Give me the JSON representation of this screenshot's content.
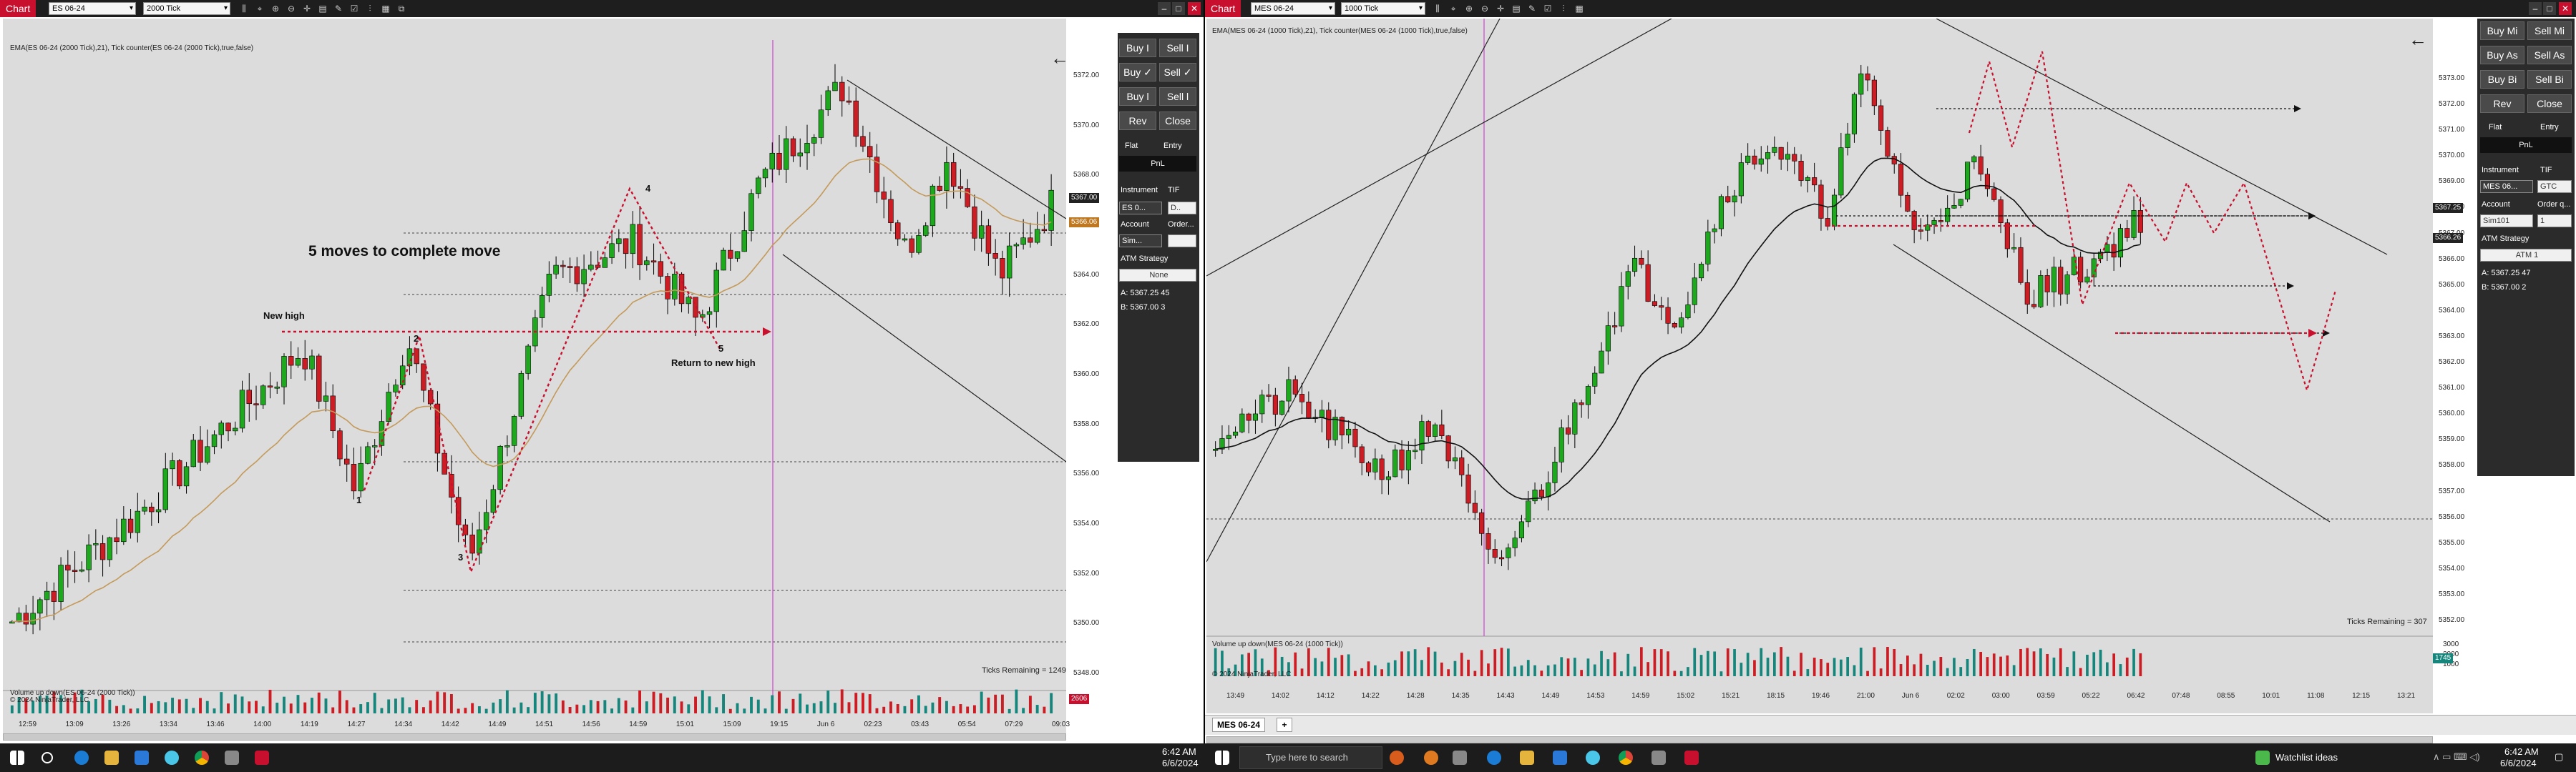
{
  "colors": {
    "up": "#1ea81e",
    "down": "#cc1d24",
    "accent": "#c8102e",
    "volume_badge": "#16867c",
    "price_badge": "#c07820",
    "ema": "#c49a5b"
  },
  "left": {
    "tab": "Chart",
    "instrument": "ES 06-24",
    "interval": "2000 Tick",
    "indicator_label": "EMA(ES 06-24 (2000 Tick),21), Tick counter(ES 06-24 (2000 Tick),true,false)",
    "annotations": {
      "title": "5 moves to complete move",
      "new_high": "New high",
      "return": "Return to new high",
      "n1": "1",
      "n2": "2",
      "n3": "3",
      "n4": "4",
      "n5": "5"
    },
    "ticks_remaining": "Ticks Remaining = 1249",
    "volume_label": "Volume up down(ES 06-24 (2000 Tick))",
    "copyright": "© 2024 NinjaTrader, LLC",
    "price_axis": [
      "5372.00",
      "5370.00",
      "5368.00",
      "5366.00",
      "5364.00",
      "5362.00",
      "5360.00",
      "5358.00",
      "5356.00",
      "5354.00",
      "5352.00",
      "5350.00",
      "5348.00"
    ],
    "price_badge_dark": "5367.00",
    "price_badge_gold": "5366.06",
    "volume_badge": "2606",
    "time_axis": [
      "12:59",
      "13:09",
      "13:26",
      "13:34",
      "13:46",
      "14:00",
      "14:19",
      "14:27",
      "14:34",
      "14:42",
      "14:49",
      "14:51",
      "14:56",
      "14:59",
      "15:01",
      "15:09",
      "19:15",
      "Jun 6",
      "02:23",
      "03:43",
      "05:54",
      "07:29",
      "09:03"
    ],
    "panel": {
      "buy1": "Buy I",
      "sell1": "Sell I",
      "buy2": "Buy ✓",
      "sell2": "Sell ✓",
      "buy3": "Buy l",
      "sell3": "Sell l",
      "rev": "Rev",
      "close": "Close",
      "flat": "Flat",
      "entry": "Entry",
      "pnl": "PnL",
      "instrument": "Instrument",
      "tif": "TIF",
      "instr_val": "ES 0...",
      "tif_val": "D..",
      "account": "Account",
      "order": "Order...",
      "account_val": "Sim...",
      "atm": "ATM Strategy",
      "atm_val": "None",
      "ask": "A:  5367.25   45",
      "bid": "B:  5367.00   3"
    }
  },
  "right": {
    "tab": "Chart",
    "instrument": "MES 06-24",
    "interval": "1000 Tick",
    "indicator_label": "EMA(MES 06-24 (1000 Tick),21), Tick counter(MES 06-24 (1000 Tick),true,false)",
    "ticks_remaining": "Ticks Remaining = 307",
    "volume_label": "Volume up down(MES 06-24 (1000 Tick))",
    "copyright": "© 2024 NinjaTrader, LLC",
    "tab_label": "MES 06-24",
    "price_axis": [
      "5373.00",
      "5372.00",
      "5371.00",
      "5370.00",
      "5369.00",
      "5368.00",
      "5367.00",
      "5366.00",
      "5365.00",
      "5364.00",
      "5363.00",
      "5362.00",
      "5361.00",
      "5360.00",
      "5359.00",
      "5358.00",
      "5357.00",
      "5356.00",
      "5355.00",
      "5354.00",
      "5353.00",
      "5352.00"
    ],
    "price_badge_a": "5367.25",
    "price_badge_b": "5366.26",
    "vol_axis": [
      "3000",
      "2000",
      "1000"
    ],
    "volume_badge": "1745",
    "time_axis": [
      "13:49",
      "14:02",
      "14:12",
      "14:22",
      "14:28",
      "14:35",
      "14:43",
      "14:49",
      "14:53",
      "14:59",
      "15:02",
      "15:21",
      "18:15",
      "19:46",
      "21:00",
      "Jun 6",
      "02:02",
      "03:00",
      "03:59",
      "05:22",
      "06:42",
      "07:48",
      "08:55",
      "10:01",
      "11:08",
      "12:15",
      "13:21"
    ],
    "panel": {
      "buy1": "Buy Mi",
      "sell1": "Sell Mi",
      "buy2": "Buy As",
      "sell2": "Sell As",
      "buy3": "Buy Bi",
      "sell3": "Sell Bi",
      "rev": "Rev",
      "close": "Close",
      "flat": "Flat",
      "entry": "Entry",
      "pnl": "PnL",
      "instrument": "Instrument",
      "tif": "TIF",
      "instr_val": "MES 06...",
      "tif_val": "GTC",
      "account": "Account",
      "order": "Order q...",
      "account_val": "Sim101",
      "qty_val": "1",
      "atm": "ATM Strategy",
      "atm_val": "ATM 1",
      "ask": "A:   5367.25     47",
      "bid": "B:   5367.00     2"
    }
  },
  "taskbar": {
    "search_placeholder": "Type here to search",
    "weather": "Watchlist ideas",
    "time_left": "6:42 AM",
    "date_left": "6/6/2024",
    "time_right": "6:42 AM",
    "date_right": "6/6/2024"
  }
}
